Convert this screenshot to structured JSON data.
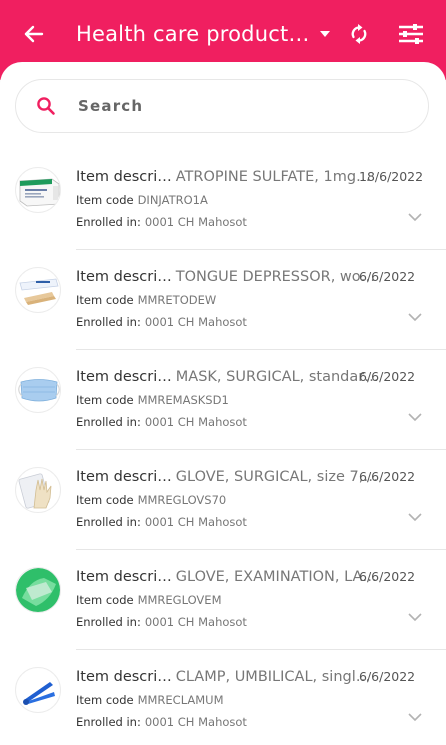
{
  "header": {
    "title": "Health care product…",
    "bg_color": "#f01f60"
  },
  "search": {
    "placeholder": "Search"
  },
  "labels": {
    "item_description": "Item descri…",
    "item_code": "Item code",
    "enrolled_in": "Enrolled in:"
  },
  "items": [
    {
      "description": "ATROPINE SULFATE, 1mg…",
      "date": "18/6/2022",
      "code": "DINJATRO1A",
      "enrolled": "0001 CH Mahosot",
      "thumbnail": "medicine-box-image"
    },
    {
      "description": "TONGUE DEPRESSOR, wo…",
      "date": "6/6/2022",
      "code": "MMRETODEW",
      "enrolled": "0001 CH Mahosot",
      "thumbnail": "tongue-depressor-image"
    },
    {
      "description": "MASK, SURGICAL, standar…",
      "date": "6/6/2022",
      "code": "MMREMASKSD1",
      "enrolled": "0001 CH Mahosot",
      "thumbnail": "surgical-mask-image"
    },
    {
      "description": "GLOVE, SURGICAL, size 7,…",
      "date": "6/6/2022",
      "code": "MMREGLOVS70",
      "enrolled": "0001 CH Mahosot",
      "thumbnail": "surgical-glove-image"
    },
    {
      "description": "GLOVE, EXAMINATION, LA…",
      "date": "6/6/2022",
      "code": "MMREGLOVEM",
      "enrolled": "0001 CH Mahosot",
      "thumbnail": "examination-glove-image"
    },
    {
      "description": "CLAMP, UMBILICAL, singl…",
      "date": "6/6/2022",
      "code": "MMRECLAMUM",
      "enrolled": "0001 CH Mahosot",
      "thumbnail": "umbilical-clamp-image"
    }
  ]
}
